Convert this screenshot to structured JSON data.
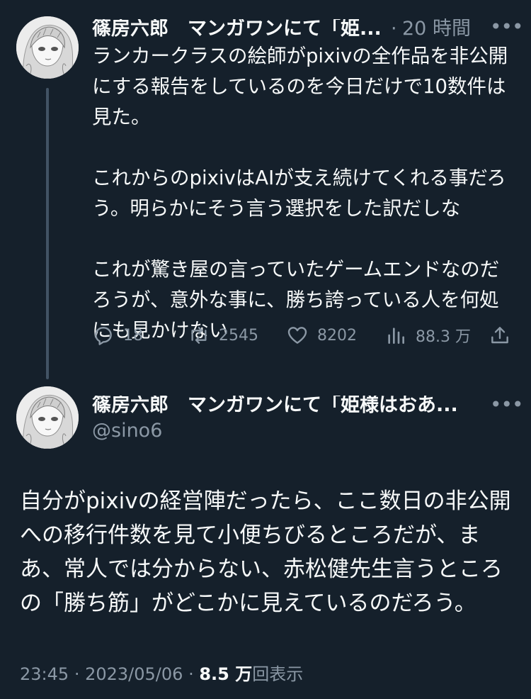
{
  "colors": {
    "background": "#15202b",
    "text_primary": "#f7f9f9",
    "text_secondary": "#8b98a5",
    "thread_line": "#425364"
  },
  "reply": {
    "author_name": "篠房六郎　マンガワンにて「姫...",
    "separator": "·",
    "time_ago": "20 時間",
    "more_icon": "more-horizontal-icon",
    "body": [
      "ランカークラスの絵師がpixivの全作品を非公開にする報告をしているのを今日だけで10数件は見た。",
      "これからのpixivはAIが支え続けてくれる事だろう。明らかにそう言う選択をした訳だしな",
      "これが驚き屋の言っていたゲームエンドなのだろうが、意外な事に、勝ち誇っている人を何処にも見かけない"
    ],
    "actions": {
      "reply_count": "18",
      "retweet_count": "2545",
      "like_count": "8202",
      "views_count": "88.3 万"
    }
  },
  "main_tweet": {
    "author_name": "篠房六郎　マンガワンにて「姫様はおあ...",
    "handle": "@sino6",
    "body": "自分がpixivの経営陣だったら、ここ数日の非公開への移行件数を見て小便ちびるところだが、まあ、常人では分からない、赤松健先生言うところの「勝ち筋」がどこかに見えているのだろう。",
    "time": "23:45",
    "separator": "·",
    "date": "2023/05/06",
    "views_number": "8.5 万",
    "views_label": "回表示"
  }
}
